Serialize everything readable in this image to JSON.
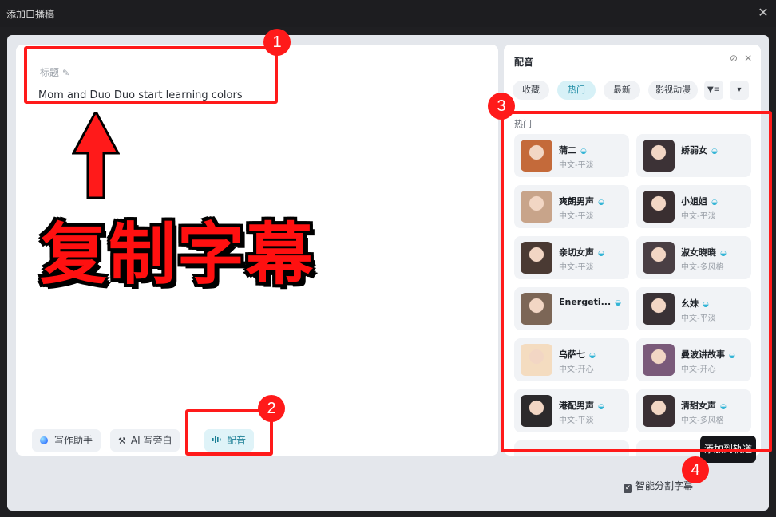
{
  "window": {
    "title": "添加口播稿",
    "close_icon": "close-icon"
  },
  "editor": {
    "title_label": "标题",
    "title_value": "Mom and Duo Duo start learning colors",
    "bottom_buttons": {
      "writing_assistant": "写作助手",
      "ai_narration": "AI 写旁白",
      "voice": "配音"
    }
  },
  "voice_panel": {
    "title": "配音",
    "tabs": [
      "收藏",
      "热门",
      "最新",
      "影视动漫"
    ],
    "active_tab": "热门",
    "section_label": "热门",
    "voices": [
      {
        "name": "蒲二",
        "desc": "中文-平淡",
        "avatar": "bear-avatar",
        "color": "#c46a3a"
      },
      {
        "name": "娇弱女",
        "desc": "",
        "avatar": "woman-avatar",
        "color": "#3c3236"
      },
      {
        "name": "爽朗男声",
        "desc": "中文-平淡",
        "avatar": "man-avatar",
        "color": "#c8a48a"
      },
      {
        "name": "小姐姐",
        "desc": "中文-平淡",
        "avatar": "woman-avatar",
        "color": "#3a2f31"
      },
      {
        "name": "亲切女声",
        "desc": "中文-平淡",
        "avatar": "woman-avatar",
        "color": "#4a3a33"
      },
      {
        "name": "淑女晓晓",
        "desc": "中文-多风格",
        "avatar": "woman-avatar",
        "color": "#4a3f44"
      },
      {
        "name": "Energeti...",
        "desc": "",
        "avatar": "man-avatar",
        "color": "#7c6656"
      },
      {
        "name": "幺妹",
        "desc": "中文-平淡",
        "avatar": "woman-avatar",
        "color": "#3a3236"
      },
      {
        "name": "乌萨七",
        "desc": "中文-开心",
        "avatar": "rabbit-avatar",
        "color": "#f4dcc0"
      },
      {
        "name": "曼波讲故事",
        "desc": "中文-开心",
        "avatar": "anime-girl-avatar",
        "color": "#7a5a7a"
      },
      {
        "name": "港配男声",
        "desc": "中文-平淡",
        "avatar": "man-avatar",
        "color": "#2c2a2c"
      },
      {
        "name": "清甜女声",
        "desc": "中文-多风格",
        "avatar": "woman-avatar",
        "color": "#3a3034"
      }
    ]
  },
  "footer": {
    "smart_split_label": "智能分割字幕",
    "add_to_track": "添加到轨道"
  },
  "annotations": {
    "badges": [
      "1",
      "2",
      "3",
      "4"
    ],
    "caption": "复制字幕",
    "color": "#ff1a1a"
  }
}
